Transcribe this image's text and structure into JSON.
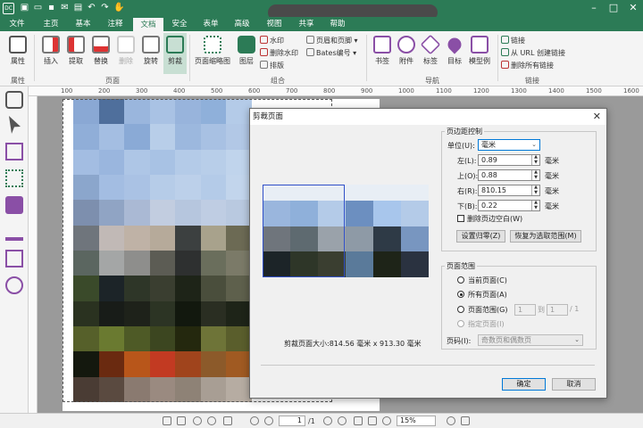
{
  "window": {
    "app_icon_label": "DC"
  },
  "menu_tabs": [
    "文件",
    "主页",
    "基本",
    "注释",
    "文档",
    "安全",
    "表单",
    "高级",
    "视图",
    "共享",
    "帮助"
  ],
  "active_tab": "文档",
  "ribbon": {
    "properties": "属性",
    "insert": "插入",
    "extract": "提取",
    "replace": "替换",
    "delete": "删除",
    "rotate": "旋转",
    "crop": "剪裁",
    "page_thumbnails": "页面缩略图",
    "layers": "图层",
    "watermark": "水印",
    "remove_watermark": "删除水印",
    "flatten": "排版",
    "header_footer": "页眉和页脚",
    "bates": "Bates编号",
    "bookmark": "书签",
    "attachment": "附件",
    "tag": "标签",
    "destination": "目标",
    "structure": "模型例",
    "link": "链接",
    "create_link_from_url": "从 URL 创建链接",
    "remove_all_links": "删除所有链接",
    "groups": {
      "properties": "属性",
      "pages": "页面",
      "combine": "组合",
      "navigation": "导航",
      "links": "链接"
    }
  },
  "ruler_ticks": [
    "100",
    "200",
    "300",
    "400",
    "500",
    "600",
    "700",
    "800",
    "900",
    "1000",
    "1100",
    "1200",
    "1300",
    "1400",
    "1500",
    "1600"
  ],
  "dialog": {
    "title": "剪裁页面",
    "margin_controls": {
      "group_label": "页边距控制",
      "unit_label": "单位(U):",
      "unit_value": "毫米",
      "left_label": "左(L):",
      "left_value": "0.89",
      "top_label": "上(O):",
      "top_value": "0.88",
      "right_label": "右(R):",
      "right_value": "810.15",
      "bottom_label": "下(B):",
      "bottom_value": "0.22",
      "unit_suffix": "毫米",
      "remove_white_margins": "删除页边空白(W)",
      "reset_button": "设置归零(Z)",
      "restore_button": "恢复为选取范围(M)"
    },
    "page_range": {
      "group_label": "页面范围",
      "current_page": "当前页面(C)",
      "all_pages": "所有页面(A)",
      "page_range": "页面范围(G)",
      "range_from": "1",
      "range_to_label": "到",
      "range_to": "1",
      "range_total": "/ 1",
      "specified_pages": "指定页面(I)",
      "subset_label": "页码(I):",
      "subset_value": "奇数页和偶数页"
    },
    "page_size_text": "剪裁页面大小:814.56 毫米 x 913.30 毫米",
    "ok_button": "确定",
    "cancel_button": "取消"
  },
  "statusbar": {
    "page_current": "1",
    "page_total": "/1",
    "zoom": "15%"
  }
}
